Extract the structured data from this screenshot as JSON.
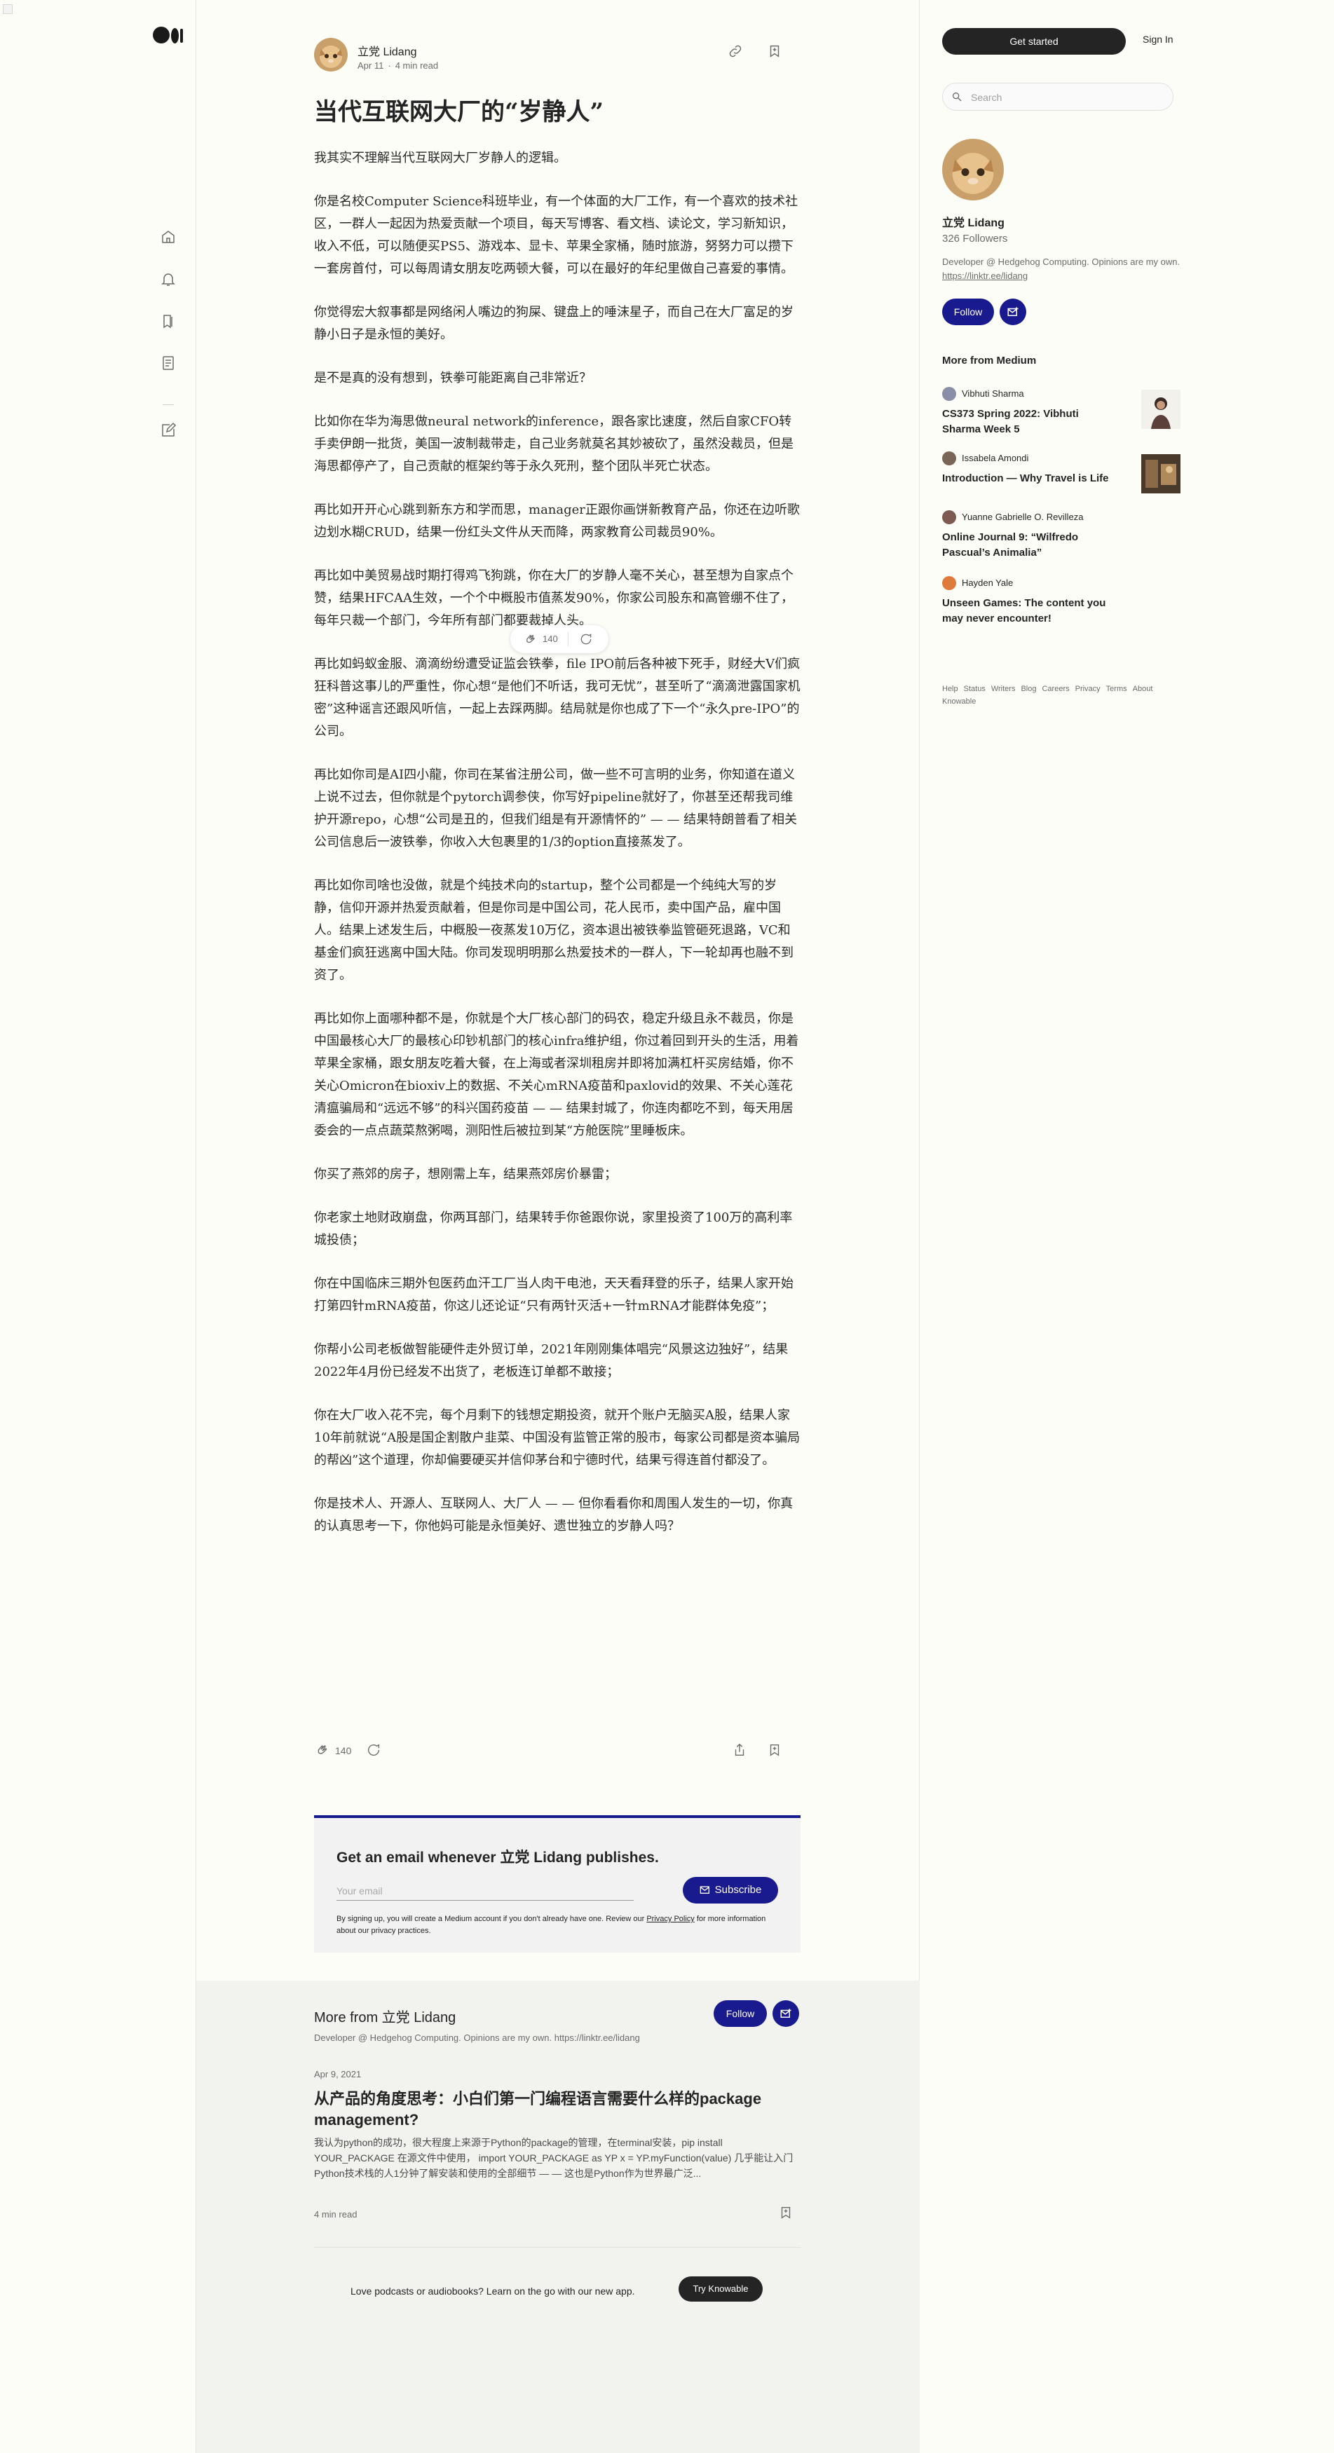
{
  "colors": {
    "accent": "#1a1a8f",
    "dark_button": "#242424",
    "page_bg": "#fdfdf8",
    "muted_text": "#6b6b6b"
  },
  "left_nav": {
    "icons": [
      "medium-logo",
      "home-icon",
      "notifications-icon",
      "lists-icon",
      "stories-icon",
      "write-icon"
    ]
  },
  "article": {
    "author": "立党 Lidang",
    "date": "Apr 11",
    "read_time": "4 min read",
    "title": "当代互联网大厂的“岁静人”",
    "paragraphs": [
      "我其实不理解当代互联网大厂岁静人的逻辑。",
      "你是名校Computer Science科班毕业，有一个体面的大厂工作，有一个喜欢的技术社区，一群人一起因为热爱贡献一个项目，每天写博客、看文档、读论文，学习新知识，收入不低，可以随便买PS5、游戏本、显卡、苹果全家桶，随时旅游，努努力可以攒下一套房首付，可以每周请女朋友吃两顿大餐，可以在最好的年纪里做自己喜爱的事情。",
      "你觉得宏大叙事都是网络闲人嘴边的狗屎、键盘上的唾沫星子，而自己在大厂富足的岁静小日子是永恒的美好。",
      "是不是真的没有想到，铁拳可能距离自己非常近？",
      "比如你在华为海思做neural network的inference，跟各家比速度，然后自家CFO转手卖伊朗一批货，美国一波制裁带走，自己业务就莫名其妙被砍了，虽然没裁员，但是海思都停产了，自己贡献的框架约等于永久死刑，整个团队半死亡状态。",
      "再比如开开心心跳到新东方和学而思，manager正跟你画饼新教育产品，你还在边听歌边划水糊CRUD，结果一份红头文件从天而降，两家教育公司裁员90%。",
      "再比如中美贸易战时期打得鸡飞狗跳，你在大厂的岁静人毫不关心，甚至想为自家点个赞，结果HFCAA生效，一个个中概股市值蒸发90%，你家公司股东和高管绷不住了，每年只裁一个部门，今年所有部门都要裁掉人头。",
      "再比如蚂蚁金服、滴滴纷纷遭受证监会铁拳，file IPO前后各种被下死手，财经大V们疯狂科普这事儿的严重性，你心想“是他们不听话，我可无忧”，甚至听了“滴滴泄露国家机密”这种谣言还跟风听信，一起上去踩两脚。结局就是你也成了下一个“永久pre-IPO”的公司。",
      "再比如你司是AI四小龍，你司在某省注册公司，做一些不可言明的业务，你知道在道义上说不过去，但你就是个pytorch调参侠，你写好pipeline就好了，你甚至还帮我司维护开源repo，心想“公司是丑的，但我们组是有开源情怀的” — — 结果特朗普看了相关公司信息后一波铁拳，你收入大包裹里的1/3的option直接蒸发了。",
      "再比如你司啥也没做，就是个纯技术向的startup，整个公司都是一个纯纯大写的岁静，信仰开源并热爱贡献着，但是你司是中国公司，花人民币，卖中国产品，雇中国人。结果上述发生后，中概股一夜蒸发10万亿，资本退出被铁拳监管砸死退路，VC和基金们疯狂逃离中国大陆。你司发现明明那么热爱技术的一群人，下一轮却再也融不到资了。",
      "再比如你上面哪种都不是，你就是个大厂核心部门的码农，稳定升级且永不裁员，你是中国最核心大厂的最核心印钞机部门的核心infra维护组，你过着回到开头的生活，用着苹果全家桶，跟女朋友吃着大餐，在上海或者深圳租房并即将加满杠杆买房结婚，你不关心Omicron在bioxiv上的数据、不关心mRNA疫苗和paxlovid的效果、不关心莲花清瘟骗局和“远远不够”的科兴国药疫苗 — — 结果封城了，你连肉都吃不到，每天用居委会的一点点蔬菜熬粥喝，测阳性后被拉到某“方舱医院”里睡板床。",
      "你买了燕郊的房子，想刚需上车，结果燕郊房价暴雷；",
      "你老家土地财政崩盘，你两耳部门，结果转手你爸跟你说，家里投资了100万的高利率城投债；",
      "你在中国临床三期外包医药血汗工厂当人肉干电池，天天看拜登的乐子，结果人家开始打第四针mRNA疫苗，你这儿还论证“只有两针灭活+一针mRNA才能群体免疫”；",
      "你帮小公司老板做智能硬件走外贸订单，2021年刚刚集体唱完“风景这边独好”，结果2022年4月份已经发不出货了，老板连订单都不敢接；",
      "你在大厂收入花不完，每个月剩下的钱想定期投资，就开个账户无脑买A股，结果人家10年前就说“A股是国企割散户韭菜、中国没有监管正常的股市，每家公司都是资本骗局的帮凶”这个道理，你却偏要硬买并信仰茅台和宁德时代，结果亏得连首付都没了。",
      "你是技术人、开源人、互联网人、大厂人 — — 但你看看你和周围人发生的一切，你真的认真思考一下，你他妈可能是永恒美好、遗世独立的岁静人吗？"
    ],
    "claps": "140"
  },
  "subscribe": {
    "title": "Get an email whenever 立党 Lidang publishes.",
    "placeholder": "Your email",
    "button": "Subscribe",
    "fine_print_a": "By signing up, you will create a Medium account if you don't already have one. Review our ",
    "fine_print_link": "Privacy Policy",
    "fine_print_b": " for more information about our privacy practices."
  },
  "more_from_author": {
    "title": "More from 立党 Lidang",
    "desc": "Developer @ Hedgehog Computing. Opinions are my own. https://linktr.ee/lidang",
    "follow": "Follow",
    "post": {
      "date": "Apr 9, 2021",
      "title": "从产品的角度思考：小白们第一门编程语言需要什么样的package management?",
      "excerpt": "我认为python的成功，很大程度上来源于Python的package的管理，在terminal安装，pip install YOUR_PACKAGE 在源文件中使用， import YOUR_PACKAGE as YP x = YP.myFunction(value) 几乎能让入门Python技术栈的人1分钟了解安装和使用的全部细节 — — 这也是Python作为世界最广泛...",
      "read_time": "4 min read"
    }
  },
  "app_promo": {
    "text": "Love podcasts or audiobooks? Learn on the go with our new app.",
    "button": "Try Knowable"
  },
  "sidebar": {
    "get_started": "Get started",
    "sign_in": "Sign In",
    "search_placeholder": "Search",
    "name": "立党 Lidang",
    "followers": "326 Followers",
    "bio": "Developer @ Hedgehog Computing. Opinions are my own. ",
    "bio_link": "https://linktr.ee/lidang",
    "follow": "Follow",
    "more_heading": "More from Medium",
    "recs": [
      {
        "author": "Vibhuti Sharma",
        "title": "CS373 Spring 2022: Vibhuti Sharma Week 5"
      },
      {
        "author": "Issabela Amondi",
        "title": "Introduction — Why Travel is Life"
      },
      {
        "author": "Yuanne Gabrielle O. Revilleza",
        "title": "Online Journal 9: “Wilfredo Pascual’s Animalia”"
      },
      {
        "author": "Hayden Yale",
        "title": "Unseen Games: The content you may never encounter!"
      }
    ],
    "footer": [
      "Help",
      "Status",
      "Writers",
      "Blog",
      "Careers",
      "Privacy",
      "Terms",
      "About",
      "Knowable"
    ]
  }
}
